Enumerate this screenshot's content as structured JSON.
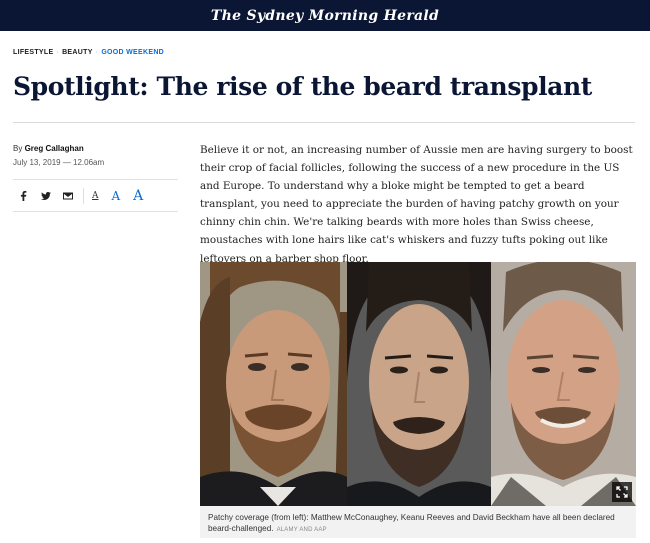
{
  "masthead": {
    "title": "The Sydney Morning Herald"
  },
  "tags": [
    "LIFESTYLE",
    "BEAUTY",
    "GOOD WEEKEND"
  ],
  "headline": "Spotlight: The rise of the beard transplant",
  "byline": {
    "prefix": "By",
    "author": "Greg Callaghan"
  },
  "dateline": "July 13, 2019 — 12.06am",
  "share": {
    "icons": [
      "facebook-icon",
      "twitter-icon",
      "email-icon"
    ]
  },
  "font_size_controls": [
    "A",
    "A",
    "A"
  ],
  "body": "Believe it or not, an increasing number of Aussie men are having surgery to boost their crop of facial follicles, following the success of a new procedure in the US and Europe. To understand why a bloke might be tempted to get a beard transplant, you need to appreciate the burden of having patchy growth on your chinny chin chin. We're talking beards with more holes than Swiss cheese, moustaches with lone hairs like cat's whiskers and fuzzy tufts poking out like leftovers on a barber shop floor.",
  "figure": {
    "caption": "Patchy coverage (from left): Matthew McConaughey, Keanu Reeves and David Beckham have all been declared beard-challenged.",
    "credit": "ALAMY AND AAP"
  },
  "colors": {
    "masthead": "#0a1633",
    "link": "#096dd2",
    "headline": "#0a1633"
  }
}
